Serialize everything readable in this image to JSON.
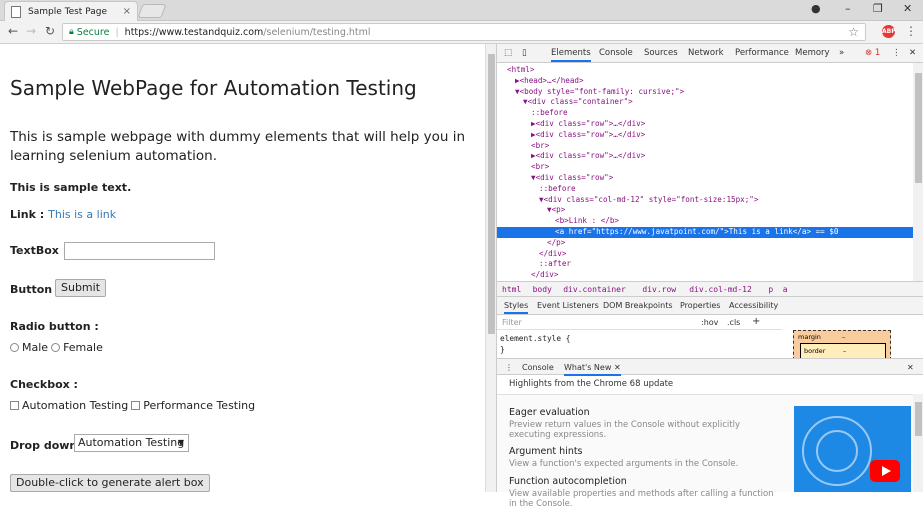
{
  "browser": {
    "tab_title": "Sample Test Page",
    "tab_close": "×",
    "secure_label": "Secure",
    "url_host": "https://www.testandquiz.com",
    "url_path": "/selenium/testing.html",
    "extension_badge": "ABP"
  },
  "page": {
    "heading": "Sample WebPage for Automation Testing",
    "intro": "This is sample webpage with dummy elements that will help you in learning selenium automation.",
    "sample_text": "This is sample text.",
    "link_label": "Link :",
    "link_text": "This is a link",
    "textbox_label": "TextBox :",
    "button_label": "Button :",
    "submit_label": "Submit",
    "radio_label": "Radio button :",
    "radio_male": "Male",
    "radio_female": "Female",
    "checkbox_label": "Checkbox :",
    "check_automation": "Automation Testing",
    "check_performance": "Performance Testing",
    "dropdown_label": "Drop down :",
    "dropdown_value": "Automation Testing",
    "dblclick_label": "Double-click to generate alert box"
  },
  "devtools": {
    "tabs": [
      "Elements",
      "Console",
      "Sources",
      "Network",
      "Performance",
      "Memory",
      "»"
    ],
    "error_count": "1",
    "code_lines": [
      {
        "indent": 0,
        "text": "<html>"
      },
      {
        "indent": 1,
        "text": "▶<head>…</head>"
      },
      {
        "indent": 1,
        "text": "▼<body style=\"font-family: cursive;\">"
      },
      {
        "indent": 2,
        "text": "▼<div class=\"container\">"
      },
      {
        "indent": 3,
        "text": "::before"
      },
      {
        "indent": 3,
        "text": "▶<div class=\"row\">…</div>"
      },
      {
        "indent": 3,
        "text": "▶<div class=\"row\">…</div>"
      },
      {
        "indent": 3,
        "text": "<br>"
      },
      {
        "indent": 3,
        "text": "▶<div class=\"row\">…</div>"
      },
      {
        "indent": 3,
        "text": "<br>"
      },
      {
        "indent": 3,
        "text": "▼<div class=\"row\">"
      },
      {
        "indent": 4,
        "text": "::before"
      },
      {
        "indent": 4,
        "text": "▼<div class=\"col-md-12\" style=\"font-size:15px;\">"
      },
      {
        "indent": 5,
        "text": "▼<p>"
      },
      {
        "indent": 6,
        "text": "<b>Link : </b>"
      },
      {
        "indent": 6,
        "text": "<a href=\"https://www.javatpoint.com/\">This is a link</a> == $0"
      },
      {
        "indent": 5,
        "text": "</p>"
      },
      {
        "indent": 4,
        "text": "</div>"
      },
      {
        "indent": 4,
        "text": "::after"
      },
      {
        "indent": 3,
        "text": "</div>"
      }
    ],
    "breadcrumbs": [
      "html",
      "body",
      "div.container",
      "div.row",
      "div.col-md-12",
      "p",
      "a"
    ],
    "sub_tabs": [
      "Styles",
      "Event Listeners",
      "DOM Breakpoints",
      "Properties",
      "Accessibility"
    ],
    "filter_placeholder": "Filter",
    "filter_hov": ":hov",
    "filter_cls": ".cls",
    "element_style": "element.style {",
    "element_style_close": "}",
    "box_margin": "margin",
    "box_border": "border",
    "box_dash": "–",
    "drawer_tabs": [
      "Console",
      "What's New"
    ],
    "highlights": "Highlights from the Chrome 68 update",
    "whats_new": [
      {
        "title": "Eager evaluation",
        "desc": "Preview return values in the Console without explicitly executing expressions."
      },
      {
        "title": "Argument hints",
        "desc": "View a function's expected arguments in the Console."
      },
      {
        "title": "Function autocompletion",
        "desc": "View available properties and methods after calling a function in the Console."
      }
    ]
  }
}
